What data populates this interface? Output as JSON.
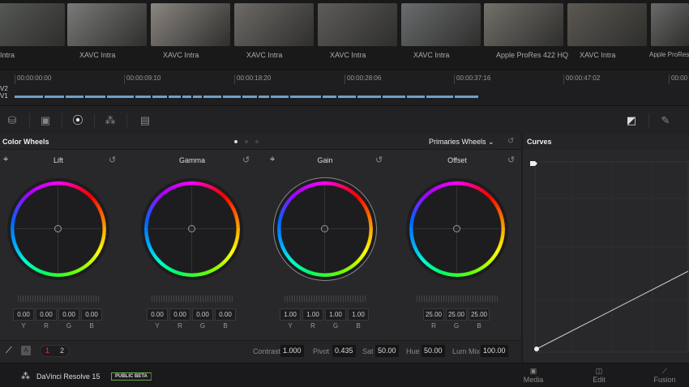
{
  "clips": [
    {
      "codec": "Intra",
      "color": "#5a5d5a"
    },
    {
      "codec": "XAVC Intra",
      "color": "#7a7a78"
    },
    {
      "codec": "XAVC Intra",
      "color": "#8a8680"
    },
    {
      "codec": "XAVC Intra",
      "color": "#6e6a66"
    },
    {
      "codec": "XAVC Intra",
      "color": "#5e5c5a"
    },
    {
      "codec": "XAVC Intra",
      "color": "#6a6c6e"
    },
    {
      "codec": "Apple ProRes 422 HQ",
      "color": "#74706a"
    },
    {
      "codec": "XAVC Intra",
      "color": "#5c5852"
    },
    {
      "codec": "Apple ProRes",
      "color": "#6a6a6a"
    }
  ],
  "timeline": {
    "timecodes": [
      "00:00:00:00",
      "00:00:09:10",
      "00:00:18:20",
      "00:00:28:06",
      "00:00:37:16",
      "00:00:47:02",
      "00:00"
    ],
    "tracks": [
      "V2",
      "V1"
    ]
  },
  "panel": {
    "title": "Color Wheels",
    "mode": "Primaries Wheels"
  },
  "curves": {
    "title": "Curves"
  },
  "wheels": [
    {
      "name": "Lift",
      "values": [
        "0.00",
        "0.00",
        "0.00",
        "0.00"
      ],
      "labels": [
        "Y",
        "R",
        "G",
        "B"
      ]
    },
    {
      "name": "Gamma",
      "values": [
        "0.00",
        "0.00",
        "0.00",
        "0.00"
      ],
      "labels": [
        "Y",
        "R",
        "G",
        "B"
      ]
    },
    {
      "name": "Gain",
      "values": [
        "1.00",
        "1.00",
        "1.00",
        "1.00"
      ],
      "labels": [
        "Y",
        "R",
        "G",
        "B"
      ]
    },
    {
      "name": "Offset",
      "values": [
        "25.00",
        "25.00",
        "25.00"
      ],
      "labels": [
        "R",
        "G",
        "B"
      ]
    }
  ],
  "bottom": {
    "auto": "A",
    "page1": "1",
    "page2": "2",
    "contrast_label": "Contrast",
    "contrast": "1.000",
    "pivot_label": "Pivot",
    "pivot": "0.435",
    "sat_label": "Sat",
    "sat": "50.00",
    "hue_label": "Hue",
    "hue": "50.00",
    "lummix_label": "Lum Mix",
    "lummix": "100.00"
  },
  "footer": {
    "app": "DaVinci Resolve 15",
    "badge": "PUBLIC BETA",
    "pages": [
      "Media",
      "Edit",
      "Fusion"
    ]
  }
}
